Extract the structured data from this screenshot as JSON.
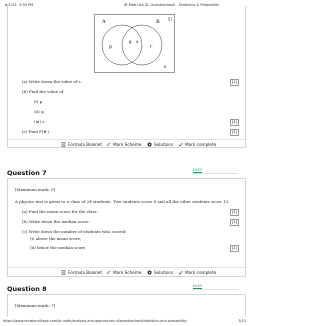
{
  "browser": {
    "datetime": "6/1/23, 3:30 PM",
    "page_title": "IB Math AA SL Questionbank - Statistics & Probability",
    "url": "https://www.revisionvillage.com/ib-math/analysis-and-approaches-sl/questionbank/statistics-and-probability/",
    "page_number": "3/15"
  },
  "question6": {
    "venn": {
      "A": "A",
      "B": "B",
      "U": "U",
      "p": "p",
      "q": "q",
      "r": "r",
      "s": "s",
      "x": "x"
    },
    "parts": [
      {
        "text": "(a) Write down the value of s.",
        "mark": "[1]"
      },
      {
        "text": "(b) Find the value of",
        "mark": ""
      },
      {
        "text": "(i) p.",
        "mark": ""
      },
      {
        "text": "(ii) q.",
        "mark": ""
      },
      {
        "text": "(iii) r.",
        "mark": "[4]"
      },
      {
        "text": "(c) Find P(B').",
        "mark": "[2]"
      }
    ],
    "toolbar": {
      "formula_booklet": "Formula Booklet",
      "mark_scheme": "Mark Scheme",
      "solutions": "Solutions",
      "mark_complete": "Mark complete"
    }
  },
  "question7": {
    "heading": "Question 7",
    "difficulty": "EASY",
    "max_mark": "[Maximum mark: 5]",
    "intro": "A physics test is given to a class of 24 students. Two students score 8 and all the other students score 13.",
    "parts": [
      {
        "text": "(a) Find the mean score for the class.",
        "mark": "[2]"
      },
      {
        "text": "(b) Write down the median score.",
        "mark": "[1]"
      },
      {
        "text": "(c) Write down the number of students who scored:",
        "mark": ""
      },
      {
        "text": "(i) above the mean score;",
        "mark": ""
      },
      {
        "text": "(ii) below the median score.",
        "mark": "[2]"
      }
    ],
    "toolbar": {
      "formula_booklet": "Formula Booklet",
      "mark_scheme": "Mark Scheme",
      "solutions": "Solutions",
      "mark_complete": "Mark complete"
    }
  },
  "question8": {
    "heading": "Question 8",
    "difficulty": "EASY",
    "max_mark": "[Maximum mark: 7]"
  },
  "colors": {
    "accent_green": "#2e8b57",
    "border": "#cfd5dc"
  }
}
